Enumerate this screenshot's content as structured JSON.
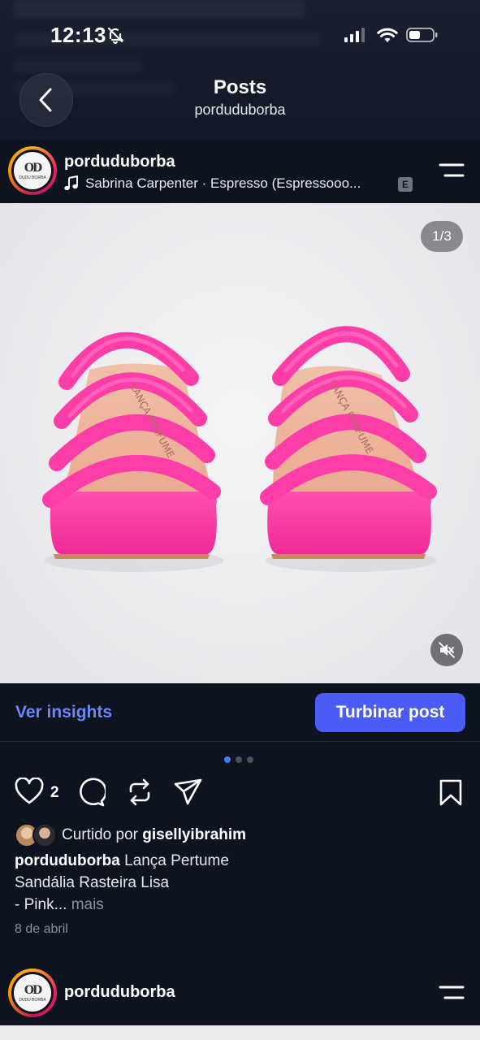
{
  "status_bar": {
    "time": "12:13"
  },
  "header": {
    "title": "Posts",
    "subtitle": "porduduborba"
  },
  "post": {
    "username": "porduduborba",
    "music": "Sabrina Carpenter · Espresso (Espressooo...",
    "explicit_badge": "E",
    "image_counter": "1/3",
    "insights_label": "Ver insights",
    "boost_label": "Turbinar post",
    "like_count": "2",
    "liked_by_prefix": "Curtido por",
    "liked_by_user": "gisellyibrahim",
    "caption_user": "porduduborba",
    "caption_line1": "Lança Pertume",
    "caption_line2": "Sandália Rasteira Lisa",
    "caption_line3": "- Pink...",
    "caption_more": "mais",
    "date": "8 de abril",
    "carousel": {
      "count": 3,
      "active": 0
    }
  },
  "next_post": {
    "username": "porduduborba"
  },
  "avatar_logo": "OD",
  "avatar_caption": "DUDU BORBA",
  "colors": {
    "accent": "#4a5cf5",
    "link": "#6f86f5",
    "product": "#ff3da8"
  }
}
